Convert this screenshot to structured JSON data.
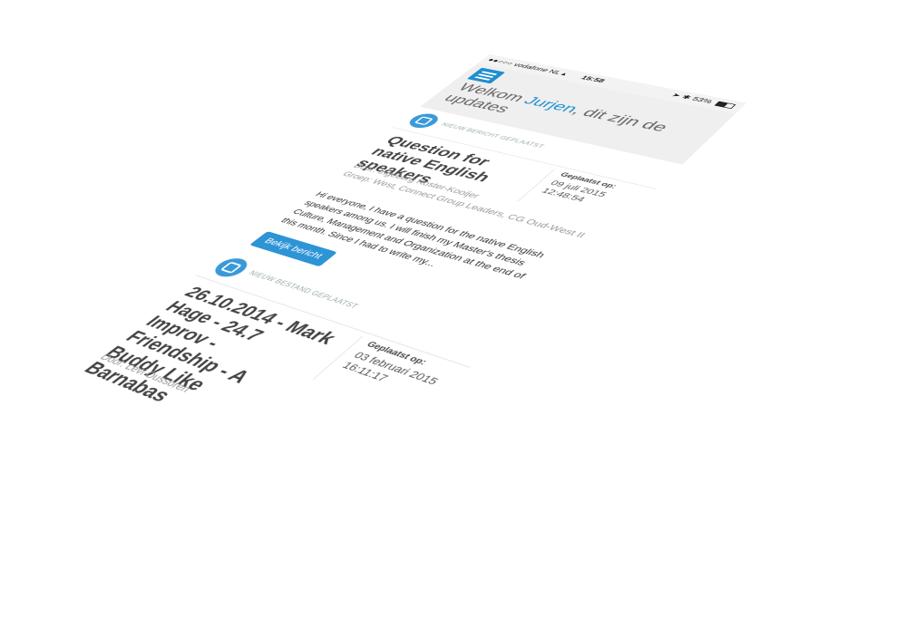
{
  "statusbar": {
    "carrier": "vodafone NL",
    "signal_dots": "●●○○○",
    "time": "15:58",
    "battery_percent": "53%"
  },
  "header": {
    "welcome_prefix": "Welkom ",
    "user_name": "Jurjen",
    "welcome_suffix": ", dit zijn de updates"
  },
  "feed": [
    {
      "type_label": "NIEUW BERICHT GEPLAATST",
      "title": "Question for native English speakers",
      "posted_label": "Geplaatst op:",
      "posted_value": "09 juli 2015 12:48:54",
      "author_line": "Door: Ingeborg Koster-Kooijer",
      "groups_line": "Groep: West, Connect Group Leaders, CG Oud-West II",
      "excerpt": "Hi everyone, I have a question for the native English speakers among us. I will finish my Master's thesis Culture, Management and Organization at the end of this month. Since I had to write my...",
      "button_label": "Bekijk bericht"
    },
    {
      "type_label": "NIEUW BESTAND GEPLAATST",
      "title": "26.10.2014 - Mark Hage - 24.7 Improv - Friendship - A Buddy Like Barnabas",
      "posted_label": "Geplaatst op:",
      "posted_value": "03 februari 2015 16:11:17",
      "author_line": "Door: Levi Oussoren"
    }
  ],
  "colors": {
    "accent": "#1e8fd0",
    "header_bg": "#efefef"
  }
}
